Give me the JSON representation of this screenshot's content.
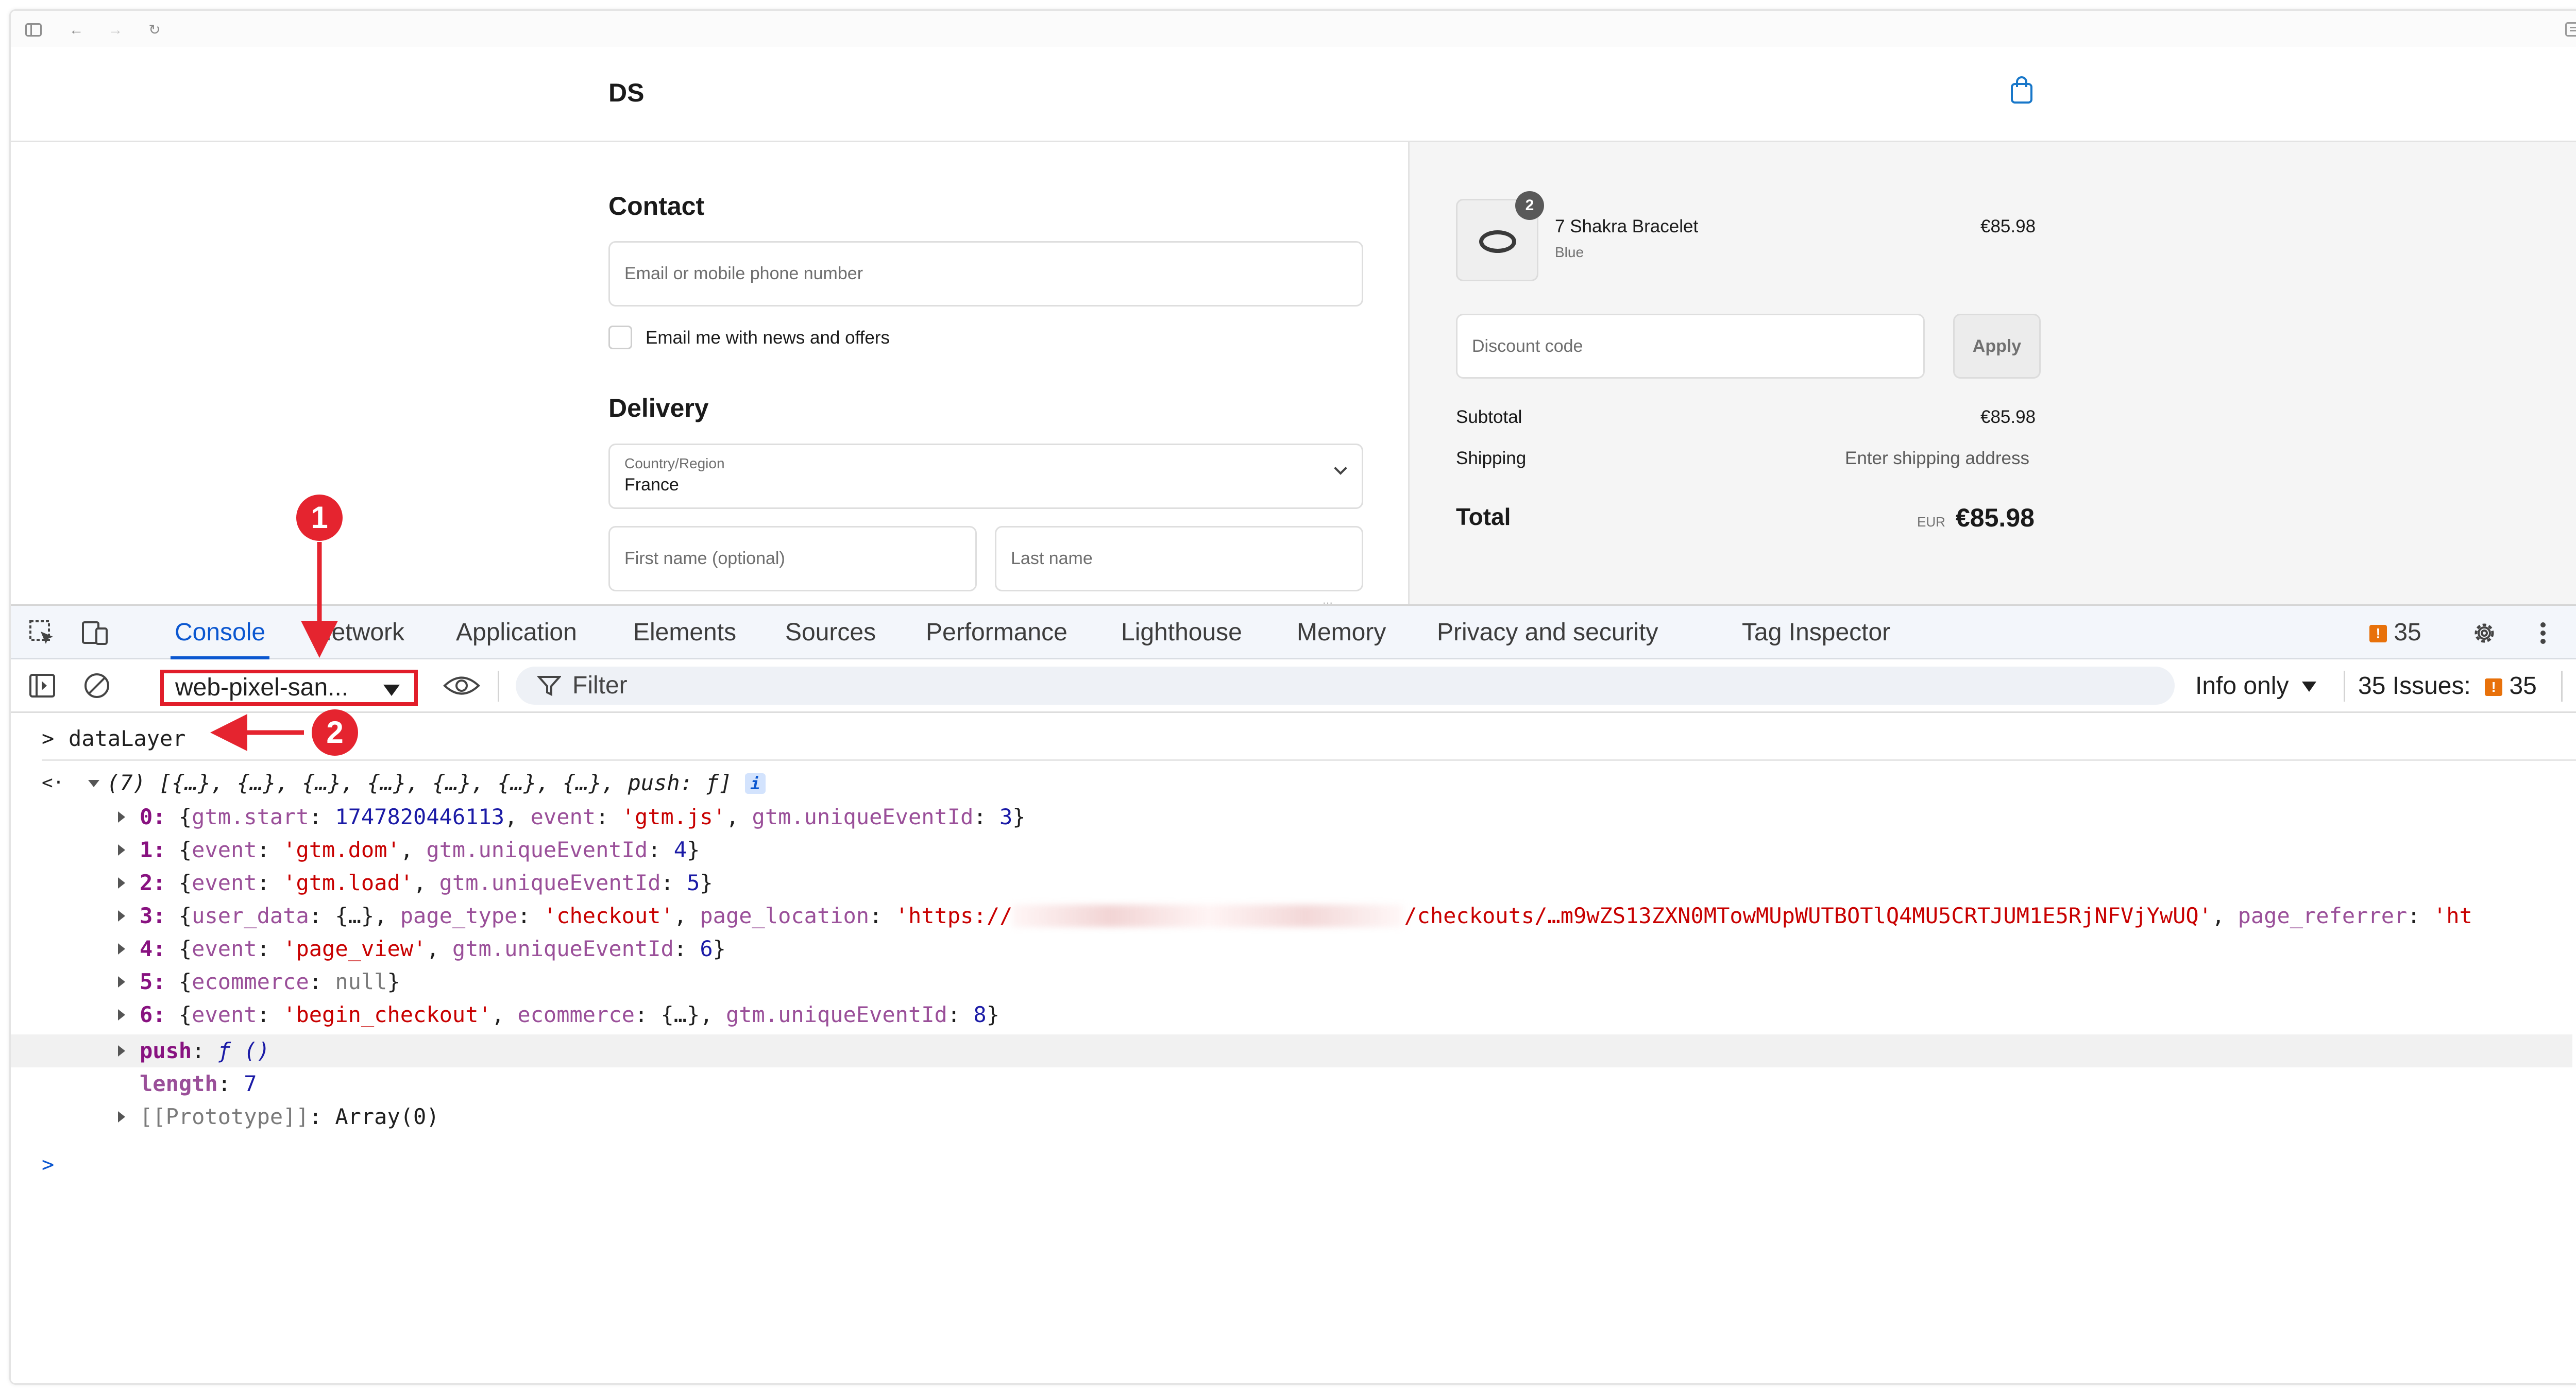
{
  "store": {
    "logo": "DS"
  },
  "contact": {
    "heading": "Contact",
    "email_placeholder": "Email or mobile phone number",
    "newsletter_label": "Email me with news and offers"
  },
  "delivery": {
    "heading": "Delivery",
    "country_label": "Country/Region",
    "country_value": "France",
    "first_name_placeholder": "First name (optional)",
    "last_name_placeholder": "Last name"
  },
  "summary": {
    "quantity_badge": "2",
    "product_name": "7 Shakra Bracelet",
    "product_variant": "Blue",
    "product_price": "€85.98",
    "discount_placeholder": "Discount code",
    "apply_label": "Apply",
    "subtotal_label": "Subtotal",
    "subtotal_value": "€85.98",
    "shipping_label": "Shipping",
    "shipping_value": "Enter shipping address",
    "total_label": "Total",
    "total_currency": "EUR",
    "total_value": "€85.98"
  },
  "devtools": {
    "tabs": [
      "Console",
      "Network",
      "Application",
      "Elements",
      "Sources",
      "Performance",
      "Lighthouse",
      "Memory",
      "Privacy and security",
      "Tag Inspector"
    ],
    "active_tab": "Console",
    "issues_count": "35",
    "context_select": "web-pixel-san...",
    "filter_placeholder": "Filter",
    "log_level": "Info only",
    "issues_label": "35 Issues:",
    "issues_badge_count": "35"
  },
  "console": {
    "input_command": "dataLayer",
    "result_summary": "(7) [{…}, {…}, {…}, {…}, {…}, {…}, {…}, push: ƒ]",
    "info_icon": "i",
    "entries": [
      {
        "index": "0:",
        "parts": [
          [
            "p",
            "{"
          ],
          [
            "kd",
            "gtm.start"
          ],
          [
            "p",
            ": "
          ],
          [
            "n",
            "1747820446113"
          ],
          [
            "p",
            ", "
          ],
          [
            "kd",
            "event"
          ],
          [
            "p",
            ": "
          ],
          [
            "s",
            "'gtm.js'"
          ],
          [
            "p",
            ", "
          ],
          [
            "kd",
            "gtm.uniqueEventId"
          ],
          [
            "p",
            ": "
          ],
          [
            "n",
            "3"
          ],
          [
            "p",
            "}"
          ]
        ]
      },
      {
        "index": "1:",
        "parts": [
          [
            "p",
            "{"
          ],
          [
            "kd",
            "event"
          ],
          [
            "p",
            ": "
          ],
          [
            "s",
            "'gtm.dom'"
          ],
          [
            "p",
            ", "
          ],
          [
            "kd",
            "gtm.uniqueEventId"
          ],
          [
            "p",
            ": "
          ],
          [
            "n",
            "4"
          ],
          [
            "p",
            "}"
          ]
        ]
      },
      {
        "index": "2:",
        "parts": [
          [
            "p",
            "{"
          ],
          [
            "kd",
            "event"
          ],
          [
            "p",
            ": "
          ],
          [
            "s",
            "'gtm.load'"
          ],
          [
            "p",
            ", "
          ],
          [
            "kd",
            "gtm.uniqueEventId"
          ],
          [
            "p",
            ": "
          ],
          [
            "n",
            "5"
          ],
          [
            "p",
            "}"
          ]
        ]
      },
      {
        "index": "3:",
        "parts": [
          [
            "p",
            "{"
          ],
          [
            "kd",
            "user_data"
          ],
          [
            "p",
            ": {…}, "
          ],
          [
            "kd",
            "page_type"
          ],
          [
            "p",
            ": "
          ],
          [
            "s",
            "'checkout'"
          ],
          [
            "p",
            ", "
          ],
          [
            "kd",
            "page_location"
          ],
          [
            "p",
            ": "
          ],
          [
            "s",
            "'https://"
          ],
          [
            "blur",
            ""
          ],
          [
            "s",
            "/checkouts/…m9wZS13ZXN0MTowMUpWUTBOTlQ4MU5CRTJUM1E5RjNFVjYwUQ'"
          ],
          [
            "p",
            ", "
          ],
          [
            "kd",
            "page_referrer"
          ],
          [
            "p",
            ": "
          ],
          [
            "s",
            "'ht"
          ]
        ]
      },
      {
        "index": "4:",
        "parts": [
          [
            "p",
            "{"
          ],
          [
            "kd",
            "event"
          ],
          [
            "p",
            ": "
          ],
          [
            "s",
            "'page_view'"
          ],
          [
            "p",
            ", "
          ],
          [
            "kd",
            "gtm.uniqueEventId"
          ],
          [
            "p",
            ": "
          ],
          [
            "n",
            "6"
          ],
          [
            "p",
            "}"
          ]
        ]
      },
      {
        "index": "5:",
        "parts": [
          [
            "p",
            "{"
          ],
          [
            "kd",
            "ecommerce"
          ],
          [
            "p",
            ": "
          ],
          [
            "g",
            "null"
          ],
          [
            "p",
            "}"
          ]
        ]
      },
      {
        "index": "6:",
        "parts": [
          [
            "p",
            "{"
          ],
          [
            "kd",
            "event"
          ],
          [
            "p",
            ": "
          ],
          [
            "s",
            "'begin_checkout'"
          ],
          [
            "p",
            ", "
          ],
          [
            "kd",
            "ecommerce"
          ],
          [
            "p",
            ": {…}, "
          ],
          [
            "kd",
            "gtm.uniqueEventId"
          ],
          [
            "p",
            ": "
          ],
          [
            "n",
            "8"
          ],
          [
            "p",
            "}"
          ]
        ]
      }
    ],
    "push_key": "push",
    "push_value": "ƒ ()",
    "length_key": "length",
    "length_value": "7",
    "prototype_key": "[[Prototype]]",
    "prototype_value": "Array(0)"
  },
  "annotations": {
    "marker_1": "1",
    "marker_2": "2",
    "color": "#e5242f"
  },
  "colors": {
    "devtools_accent": "#0b57d0",
    "string": "#c80000",
    "number": "#1a1aa6",
    "key": "#881280",
    "issue_flag": "#e8710a"
  }
}
